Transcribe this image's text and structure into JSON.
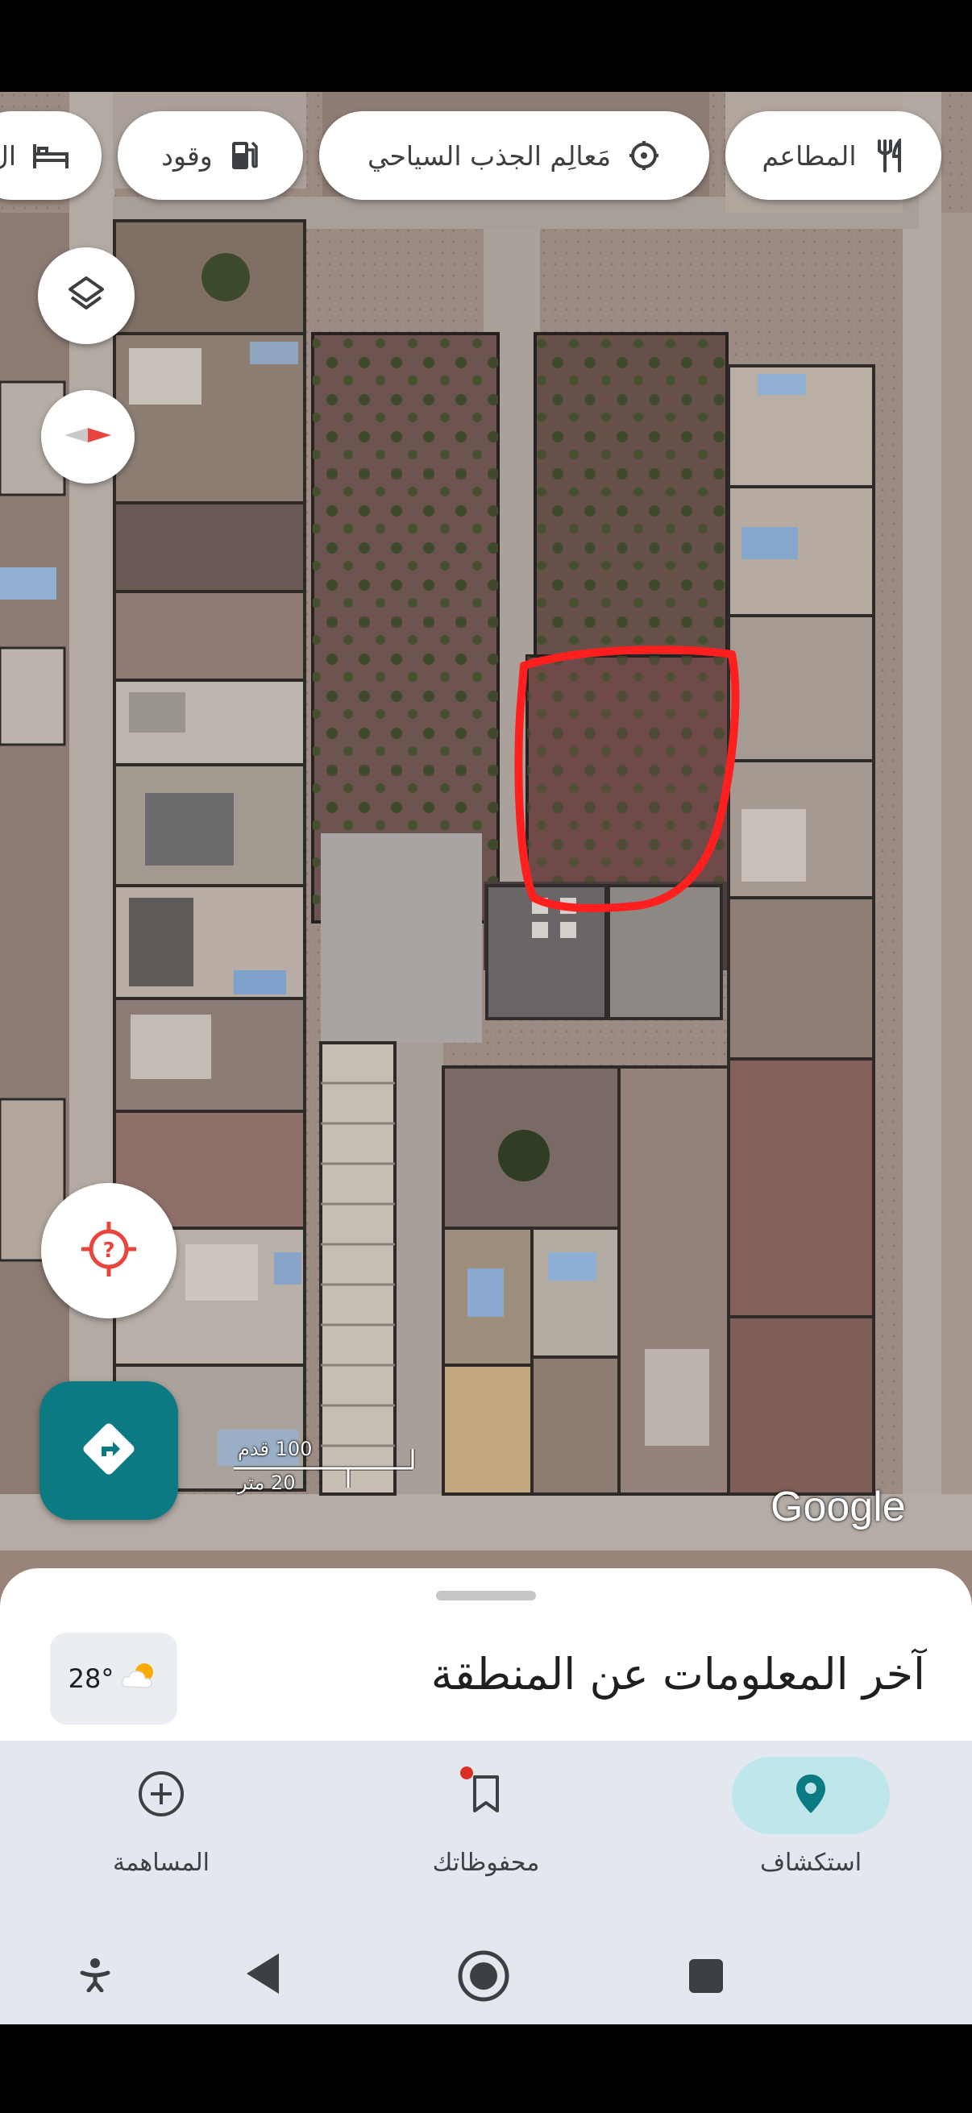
{
  "categories": {
    "restaurants": "المطاعم",
    "attractions": "مَعالِم الجذب السياحي",
    "fuel": "وقود",
    "lodging": "ال"
  },
  "scale": {
    "feet": "100 قدم",
    "meters": "20 متر"
  },
  "watermark": "Google",
  "sheet": {
    "title": "آخر المعلومات عن المنطقة",
    "temperature": "28°"
  },
  "tabs": [
    {
      "label": "استكشاف",
      "icon": "location-pin-icon",
      "active": true
    },
    {
      "label": "محفوظاتك",
      "icon": "bookmark-icon",
      "has_badge": true
    },
    {
      "label": "المساهمة",
      "icon": "add-circle-icon"
    }
  ],
  "colors": {
    "accent": "#0b7a83",
    "active_pill": "#bfe6ea",
    "highlight_outline": "#ff1f1f",
    "badge": "#d93025",
    "nav_background": "#e3e8ee"
  }
}
